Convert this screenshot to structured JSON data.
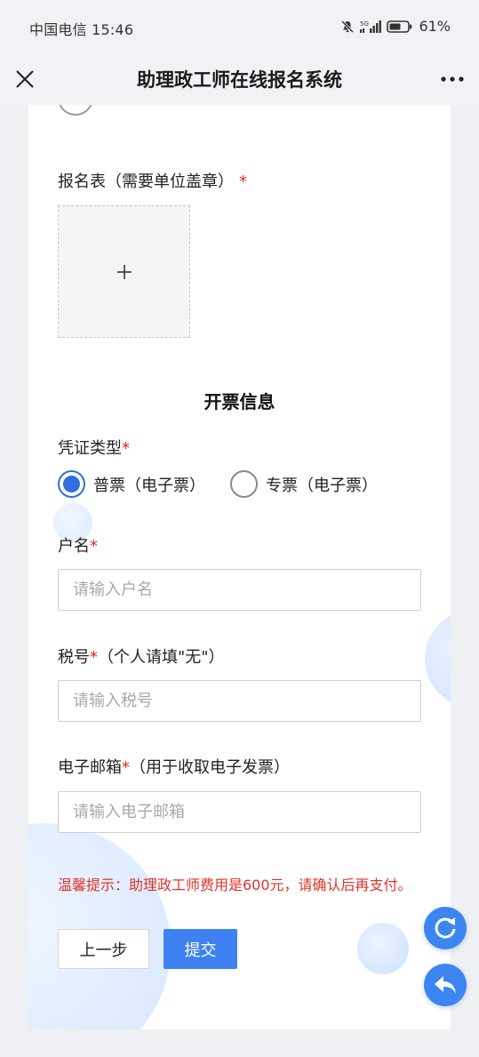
{
  "status_bar": {
    "carrier_time": "中国电信 15:46",
    "network_label": "5G",
    "battery": "61%"
  },
  "title_bar": {
    "title": "助理政工师在线报名系统",
    "close_icon": "close-icon",
    "more_icon": "more-horizontal-icon"
  },
  "form": {
    "registration_form_label": "报名表（需要单位盖章）",
    "required_mark": "*",
    "upload_plus": "+",
    "invoice_section_title": "开票信息",
    "voucher_type_label": "凭证类型",
    "voucher_options": [
      {
        "label": "普票（电子票）",
        "checked": true
      },
      {
        "label": "专票（电子票）",
        "checked": false
      }
    ],
    "account_name_label": "户名",
    "account_name_placeholder": "请输入户名",
    "tax_no_label": "税号",
    "tax_no_hint": "（个人请填\"无\"）",
    "tax_no_placeholder": "请输入税号",
    "email_label": "电子邮箱",
    "email_hint": "（用于收取电子发票）",
    "email_placeholder": "请输入电子邮箱",
    "tip": "温馨提示：助理政工师费用是600元，请确认后再支付。",
    "prev_button": "上一步",
    "submit_button": "提交"
  },
  "floating": {
    "refresh_icon": "refresh-icon",
    "back_icon": "reply-back-icon"
  },
  "colors": {
    "accent": "#3e82f2",
    "required": "#e12626",
    "tip": "#e0322a"
  }
}
